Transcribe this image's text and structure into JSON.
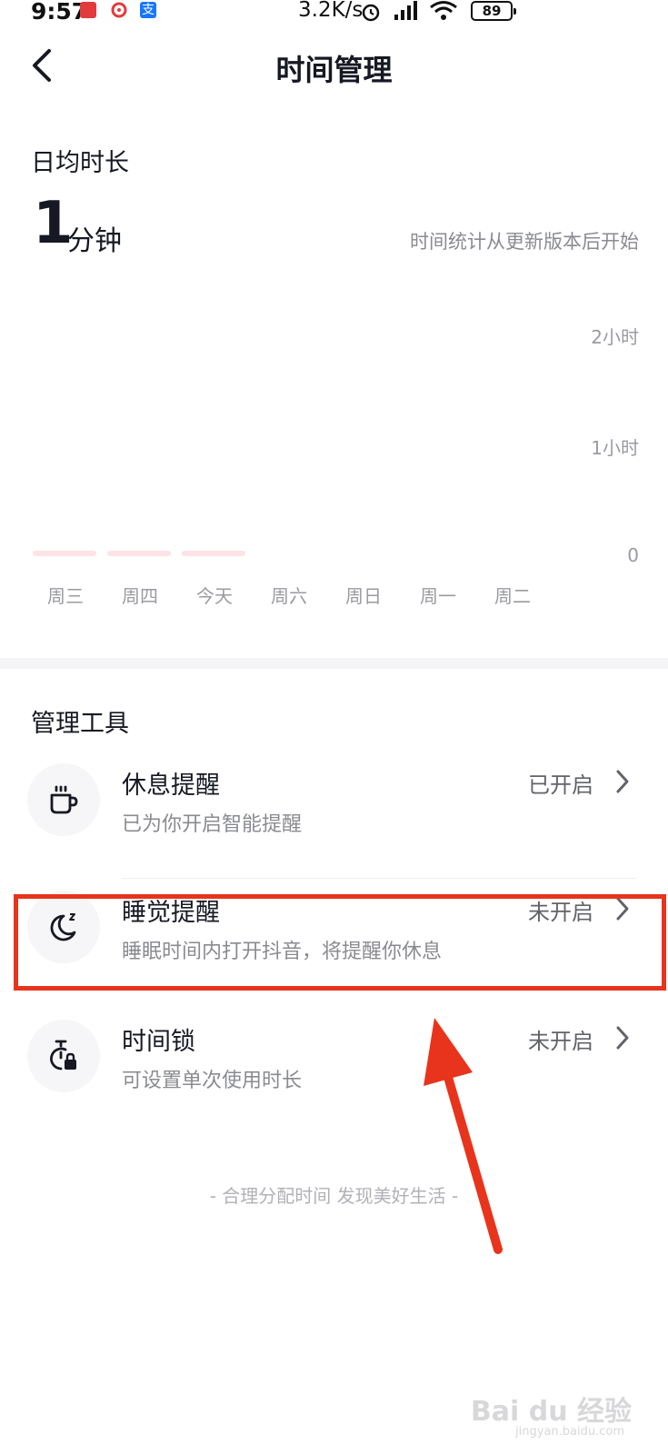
{
  "status_bar": {
    "time": "9:57",
    "net_speed": "3.2K/s",
    "battery": "89",
    "icons": [
      "app-notification-icon",
      "app-notification-icon-2",
      "alipay-icon",
      "alarm-icon",
      "signal-icon",
      "wifi-icon",
      "battery-icon"
    ]
  },
  "header": {
    "back_icon": "chevron-left-icon",
    "title": "时间管理"
  },
  "summary": {
    "label": "日均时长",
    "value_number": "1",
    "value_unit": "分钟",
    "note": "时间统计从更新版本后开始"
  },
  "chart_data": {
    "type": "bar",
    "categories": [
      "周三",
      "周四",
      "今天",
      "周六",
      "周日",
      "周一",
      "周二"
    ],
    "values": [
      1,
      1,
      1,
      0,
      0,
      0,
      0
    ],
    "y_ticks": [
      "2小时",
      "1小时",
      "0"
    ],
    "ylim": [
      0,
      120
    ],
    "grid": false,
    "bar_color": "#fde3e6"
  },
  "tools": {
    "section_title": "管理工具",
    "items": [
      {
        "icon": "coffee-cup-icon",
        "title": "休息提醒",
        "desc": "已为你开启智能提醒",
        "status": "已开启"
      },
      {
        "icon": "moon-sleep-icon",
        "title": "睡觉提醒",
        "desc": "睡眠时间内打开抖音，将提醒你休息",
        "status": "未开启"
      },
      {
        "icon": "timer-lock-icon",
        "title": "时间锁",
        "desc": "可设置单次使用时长",
        "status": "未开启"
      }
    ],
    "chevron_icon": "chevron-right-icon"
  },
  "footer": {
    "slogan": "- 合理分配时间 发现美好生活 -"
  },
  "annotation": {
    "highlight_color": "#e8341c",
    "arrow_icon": "red-arrow-icon"
  },
  "watermark": {
    "text": "Bai du 经验",
    "sub": "jingyan.baidu.com"
  }
}
